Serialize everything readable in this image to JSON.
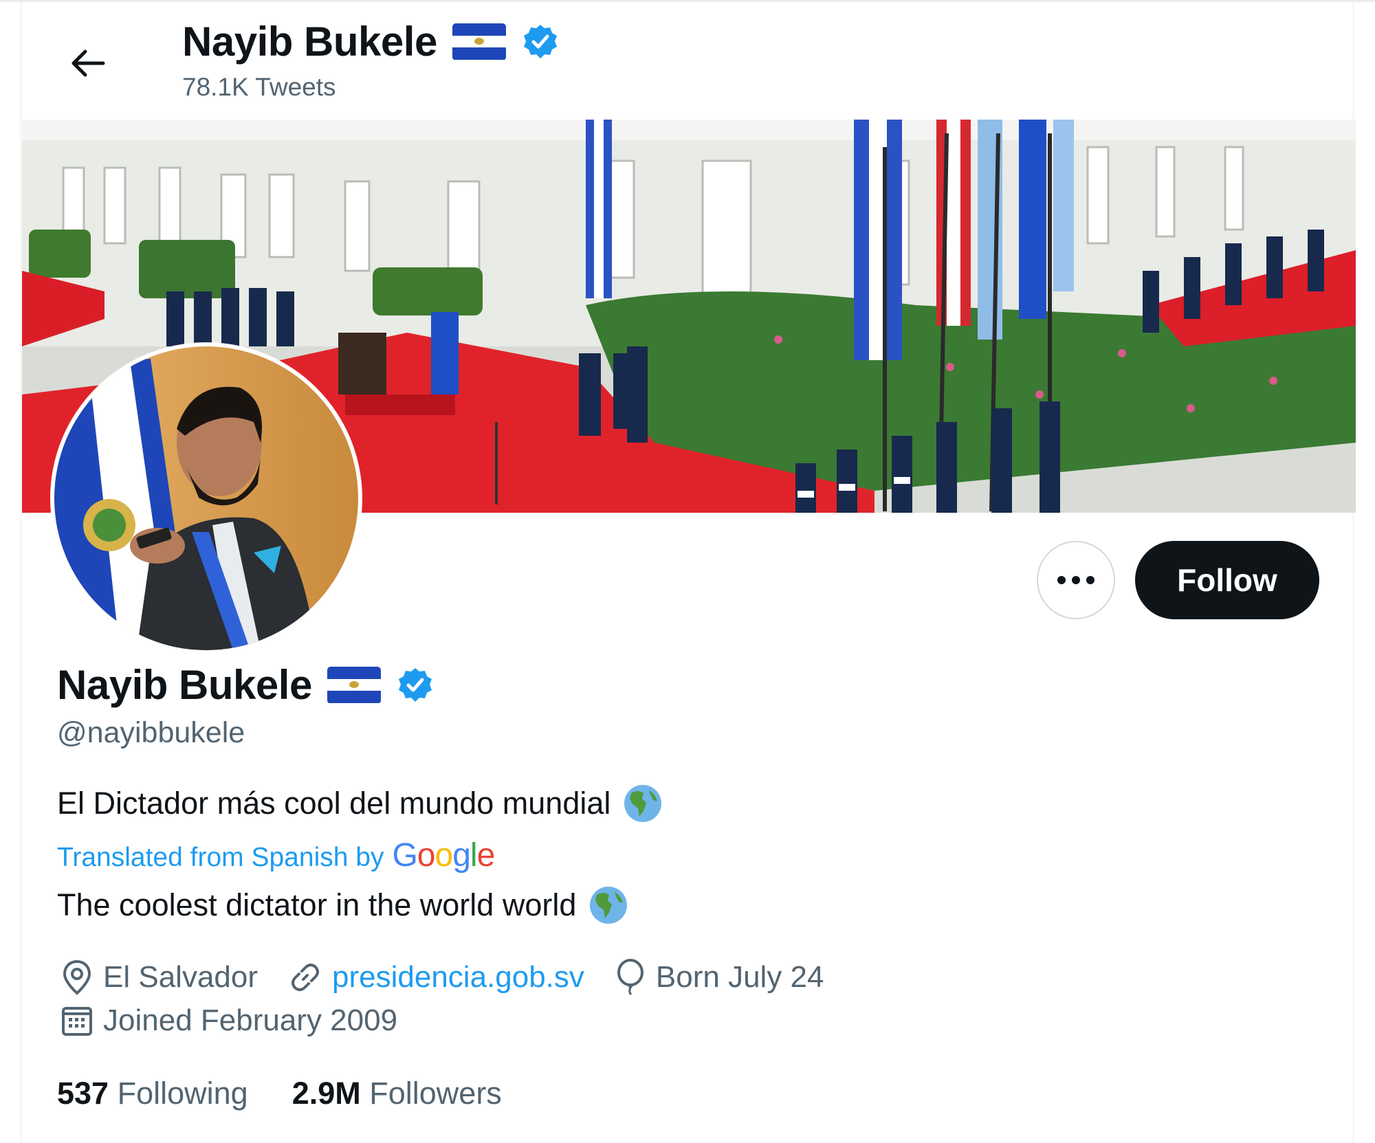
{
  "header": {
    "name": "Nayib Bukele",
    "tweet_count": "78.1K Tweets"
  },
  "profile": {
    "name": "Nayib Bukele",
    "handle": "@nayibbukele",
    "bio": "El Dictador más cool del mundo mundial",
    "bio_emoji": "globe-americas",
    "translated_label": "Translated from Spanish by",
    "translation_provider": "Google",
    "bio_translated": "The coolest dictator in the world world",
    "location": "El Salvador",
    "website": "presidencia.gob.sv",
    "birthday": "Born July 24",
    "joined": "Joined February 2009"
  },
  "actions": {
    "follow_label": "Follow",
    "more_icon": "more-horizontal-icon"
  },
  "stats": {
    "following_count": "537",
    "following_label": "Following",
    "followers_count": "2.9M",
    "followers_label": "Followers"
  },
  "icons": {
    "back": "arrow-left-icon",
    "verified": "verified-badge-icon",
    "location": "location-pin-icon",
    "link": "link-icon",
    "birthday": "balloon-icon",
    "joined": "calendar-icon"
  },
  "colors": {
    "accent": "#1d9bf0",
    "text_primary": "#0f1419",
    "text_secondary": "#536471",
    "follow_bg": "#0f1419",
    "flag_blue": "#1e46b8",
    "google_blue": "#4285f4",
    "google_red": "#ea4335",
    "google_yellow": "#fbbc05",
    "google_green": "#34a853"
  }
}
